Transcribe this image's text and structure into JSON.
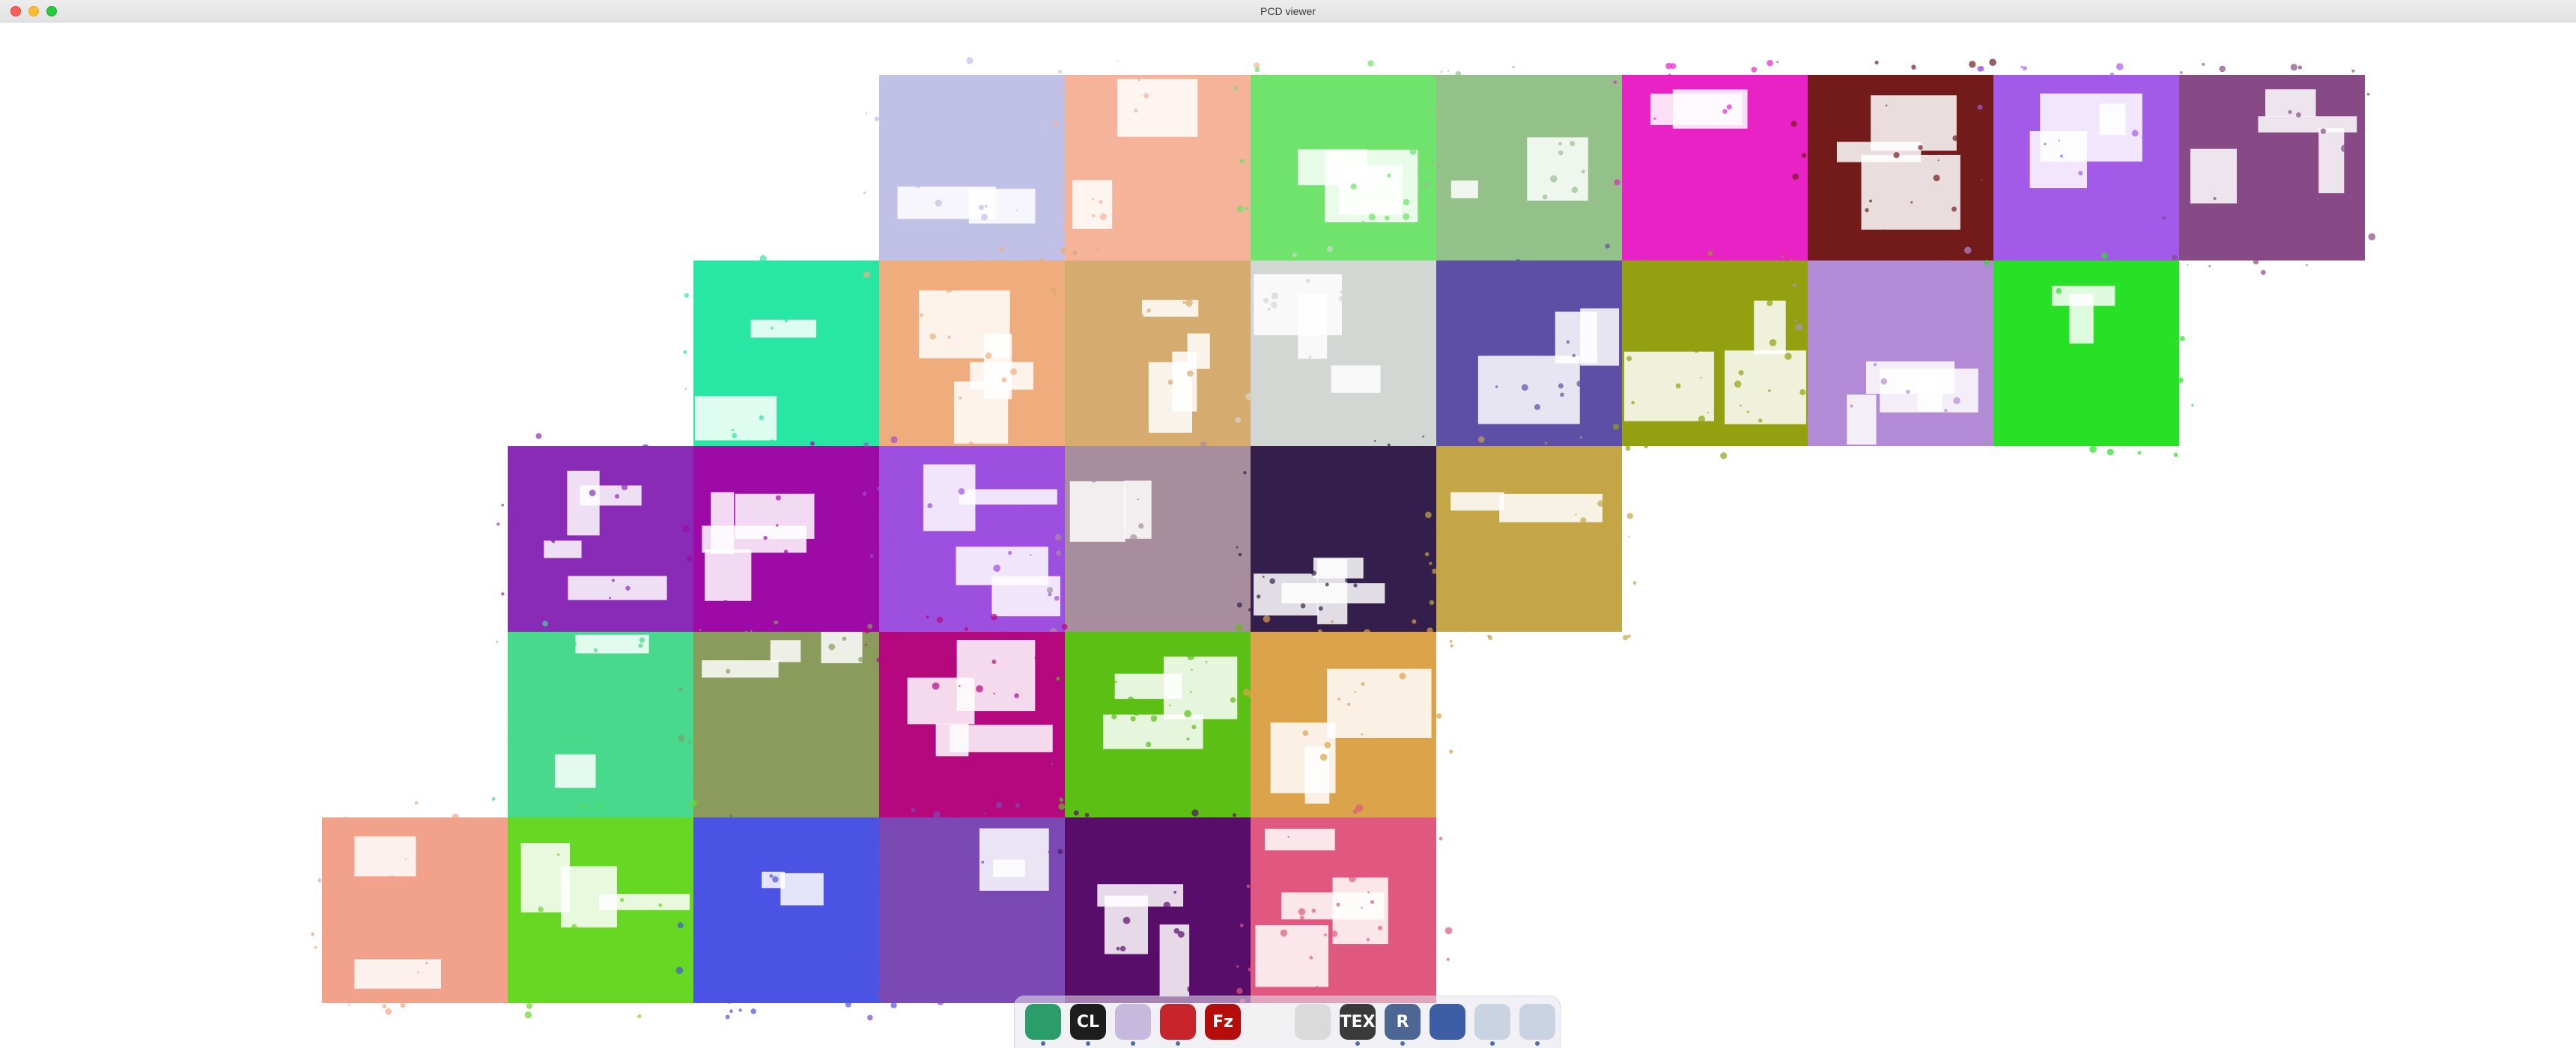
{
  "window": {
    "title": "PCD viewer"
  },
  "viewport": {
    "background": "#ffffff",
    "tile_colors": [
      "#c1c1e8",
      "#f5b39a",
      "#6fe36b",
      "#94c08a",
      "#e922c6",
      "#731b1b",
      "#a45ae8",
      "#874a86",
      "#28e6a3",
      "#efac7c",
      "#d5ab6f",
      "#d3d7d3",
      "#5e4fa6",
      "#93a010",
      "#b28ad6",
      "#28e025",
      "#8a2bb8",
      "#9e0aa6",
      "#9d4fe0",
      "#a88e9d",
      "#341f4c",
      "#c5a646",
      "#48d98c",
      "#8a9b5c",
      "#b5087f",
      "#5bbf14",
      "#dba34a",
      "#f2a28a",
      "#66d823",
      "#4a53e3",
      "#7a49b3",
      "#590d6a",
      "#e0587f"
    ]
  },
  "dock": {
    "items": [
      {
        "icon": "chrome-browser-icon",
        "label": "",
        "color": "#2a9d6a",
        "running": true
      },
      {
        "icon": "clion-icon",
        "label": "CL",
        "color": "#1d1d1d",
        "running": true
      },
      {
        "icon": "folder-icon",
        "label": "",
        "color": "#c7b8de",
        "running": true
      },
      {
        "icon": "redis-desktop-icon",
        "label": "",
        "color": "#c8242b",
        "running": true
      },
      {
        "icon": "filezilla-icon",
        "label": "Fz",
        "color": "#b50c0c",
        "running": false
      },
      {
        "icon": "browser-icon",
        "label": "",
        "color": "#f2f2f2",
        "running": false
      },
      {
        "icon": "toggle-settings-icon",
        "label": "",
        "color": "#dadada",
        "running": false
      },
      {
        "icon": "tex-icon",
        "label": "TEX",
        "color": "#3a3a3a",
        "running": true
      },
      {
        "icon": "rstudio-icon",
        "label": "R",
        "color": "#4d6794",
        "running": true
      },
      {
        "icon": "screenshot-camera-icon",
        "label": "",
        "color": "#3b5ea6",
        "running": false
      },
      {
        "icon": "window-icon",
        "label": "",
        "color": "#c9d3e2",
        "running": true
      },
      {
        "icon": "window-icon-2",
        "label": "",
        "color": "#c9d3e2",
        "running": true
      }
    ]
  }
}
